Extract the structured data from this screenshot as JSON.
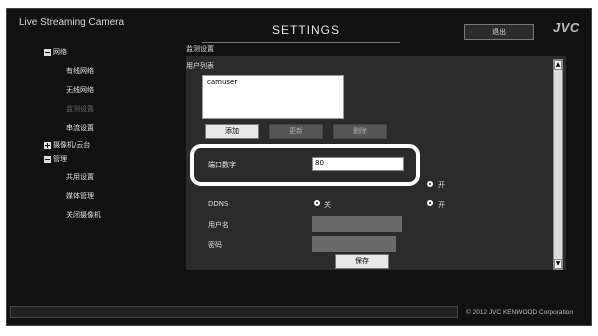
{
  "app_title": "Live Streaming Camera",
  "page_title": "SETTINGS",
  "exit_label": "退出",
  "logo": "JVC",
  "sidebar": {
    "items": [
      {
        "label": "网络",
        "type": "group-open"
      },
      {
        "label": "有线网络",
        "type": "item"
      },
      {
        "label": "无线网络",
        "type": "item"
      },
      {
        "label": "监测设置",
        "type": "item-dim"
      },
      {
        "label": "串流设置",
        "type": "item"
      },
      {
        "label": "摄像机/云台",
        "type": "group-closed"
      },
      {
        "label": "管理",
        "type": "group-open"
      },
      {
        "label": "共用设置",
        "type": "item"
      },
      {
        "label": "媒体管理",
        "type": "item"
      },
      {
        "label": "关闭摄像机",
        "type": "item"
      }
    ]
  },
  "main": {
    "section_title": "监测设置",
    "user_list_label": "用户列表",
    "users": [
      "camuser"
    ],
    "buttons": {
      "add": "添加",
      "update": "更新",
      "delete": "删除"
    },
    "port": {
      "label": "端口数字",
      "value": "80"
    },
    "on_label": "开",
    "off_label": "关",
    "ddns": {
      "label": "DDNS",
      "off": "关",
      "on": "开"
    },
    "username": {
      "label": "用户名",
      "value": ""
    },
    "password": {
      "label": "密码",
      "value": ""
    },
    "save": "保存"
  },
  "footer": {
    "copyright": "© 2012 JVC KENWOOD Corporation"
  },
  "colors": {
    "background": "#111111",
    "panel": "#2b2b2b",
    "highlight": "#ffffff"
  }
}
